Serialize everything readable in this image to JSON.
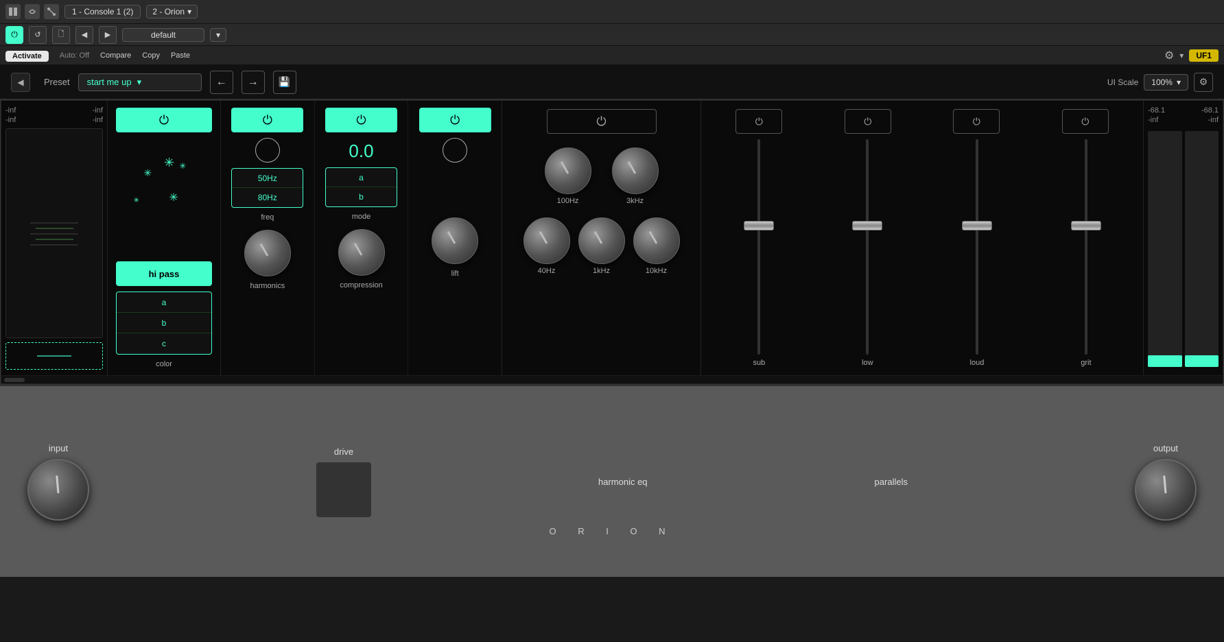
{
  "topbar": {
    "icons": [
      "panels",
      "undo",
      "routing"
    ],
    "track": "1 - Console 1 (2)",
    "plugin": "2 - Orion",
    "powerLabel": "⏻",
    "undoLabel": "↺",
    "fileLabel": "🗋",
    "prevLabel": "◀",
    "nextLabel": "▶",
    "preset": "default",
    "autoText": "Auto: Off",
    "compareLabel": "Compare",
    "copyLabel": "Copy",
    "pasteLabel": "Paste",
    "activateLabel": "Activate",
    "uf1Badge": "UF1",
    "gearSymbol": "⚙"
  },
  "pluginHeader": {
    "presetLabel": "Preset",
    "presetValue": "start me up",
    "prevArrow": "←",
    "nextArrow": "→",
    "saveIcon": "💾",
    "uiScaleLabel": "UI Scale",
    "uiScaleValue": "100%",
    "settingsIcon": "⚙",
    "backIcon": "◀"
  },
  "outputMeters": {
    "topLeft": "-68.1",
    "topRight": "-68.1",
    "botLeft": "-inf",
    "botRight": "-inf",
    "topLeftLabel": "-inf",
    "topRightLabel": "-inf",
    "botLeftLabel": "-inf",
    "botRightLabel": "-inf"
  },
  "colorSection": {
    "powerLabel": "⏻",
    "hiPassLabel": "hi pass",
    "colorOptions": [
      "a",
      "b",
      "c"
    ],
    "sectionLabel": "color"
  },
  "driveSection": {
    "freqValues": [
      "50Hz",
      "80Hz"
    ],
    "freqLabel": "freq",
    "modeValues": [
      "a",
      "b"
    ],
    "modeLabel": "mode",
    "centerValue": "0.0",
    "powerLabel": "⏻",
    "knobs": {
      "harmonics": "harmonics",
      "compression": "compression",
      "lift": "lift"
    }
  },
  "harmonicEQ": {
    "powerLabel": "⏻",
    "sectionTitle": "harmonic eq",
    "knobs": [
      {
        "label": "100Hz",
        "pos": "left"
      },
      {
        "label": "3kHz",
        "pos": "left"
      }
    ],
    "knobs2": [
      {
        "label": "40Hz",
        "pos": "left"
      },
      {
        "label": "1kHz",
        "pos": "left"
      },
      {
        "label": "10kHz",
        "pos": "left"
      }
    ]
  },
  "parallels": {
    "sectionTitle": "parallels",
    "powers": [
      "⏻",
      "⏻",
      "⏻",
      "⏻"
    ],
    "faders": [
      {
        "label": "sub"
      },
      {
        "label": "low"
      },
      {
        "label": "loud"
      },
      {
        "label": "grit"
      }
    ]
  },
  "bottomSection": {
    "inputLabel": "input",
    "driveLabel": "drive",
    "harmonicEqLabel": "harmonic eq",
    "parallelsLabel": "parallels",
    "outputLabel": "output",
    "orionText": "O  R  I  O  N"
  }
}
